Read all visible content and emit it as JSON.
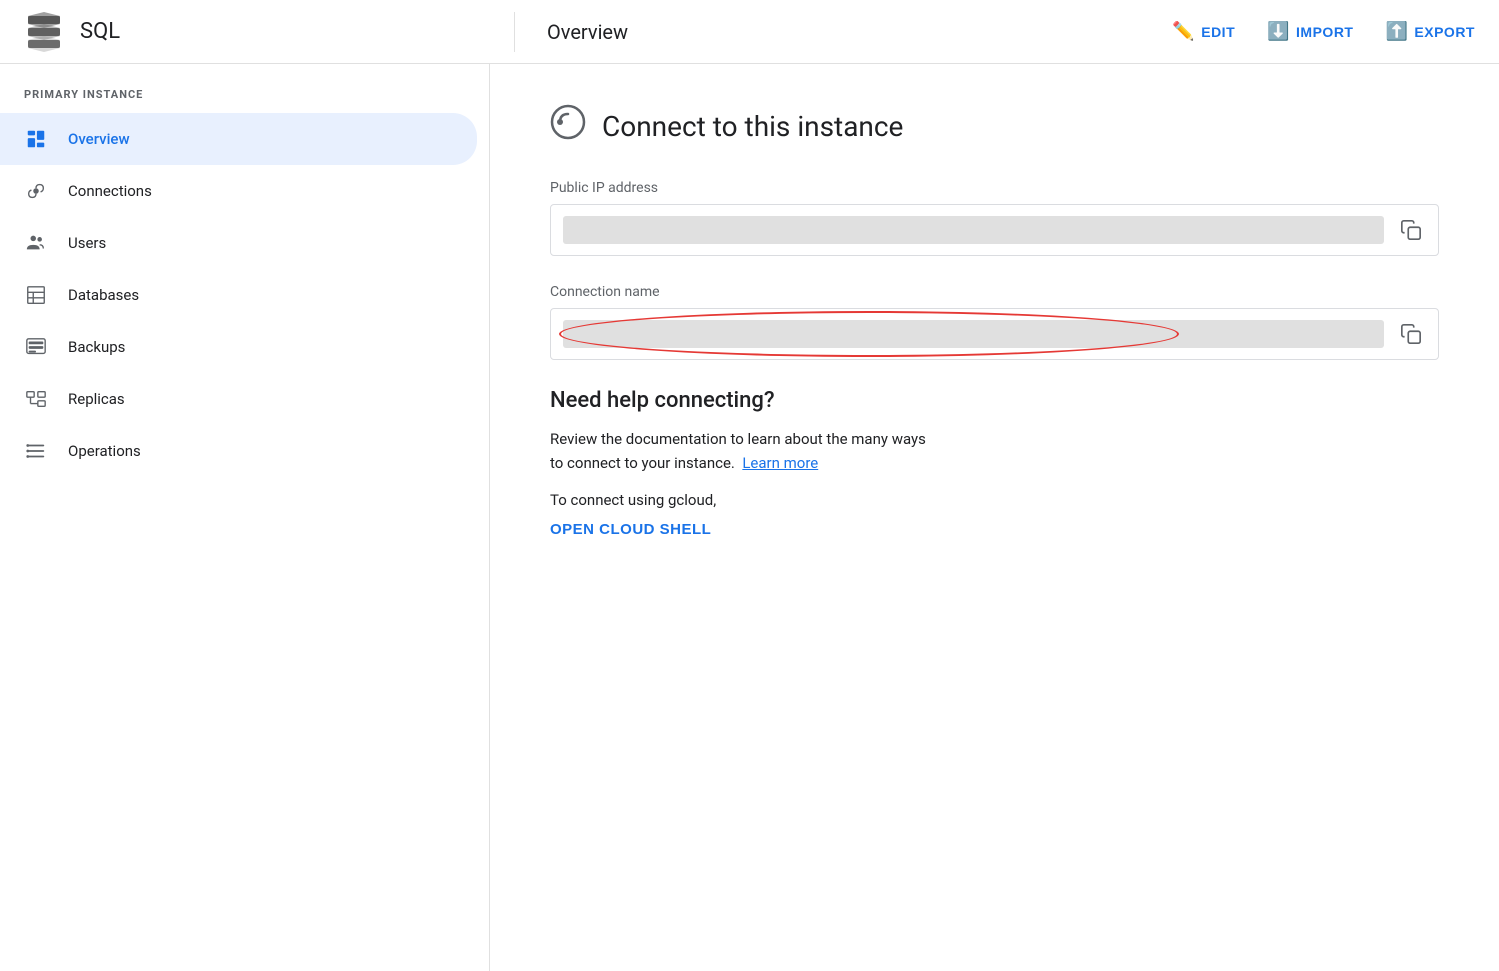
{
  "header": {
    "title": "SQL",
    "page_title": "Overview",
    "edit_label": "EDIT",
    "import_label": "IMPORT",
    "export_label": "EXPORT"
  },
  "sidebar": {
    "section_label": "PRIMARY INSTANCE",
    "items": [
      {
        "id": "overview",
        "label": "Overview",
        "active": true
      },
      {
        "id": "connections",
        "label": "Connections",
        "active": false
      },
      {
        "id": "users",
        "label": "Users",
        "active": false
      },
      {
        "id": "databases",
        "label": "Databases",
        "active": false
      },
      {
        "id": "backups",
        "label": "Backups",
        "active": false
      },
      {
        "id": "replicas",
        "label": "Replicas",
        "active": false
      },
      {
        "id": "operations",
        "label": "Operations",
        "active": false
      }
    ]
  },
  "content": {
    "connect_title": "Connect to this instance",
    "public_ip_label": "Public IP address",
    "connection_name_label": "Connection name",
    "help_title": "Need help connecting?",
    "help_text_1": "Review the documentation to learn about the many ways",
    "help_text_2": "to connect to your instance.",
    "help_link": "Learn more",
    "gcloud_text": "To connect using gcloud,",
    "open_cloud_shell": "OPEN CLOUD SHELL"
  }
}
